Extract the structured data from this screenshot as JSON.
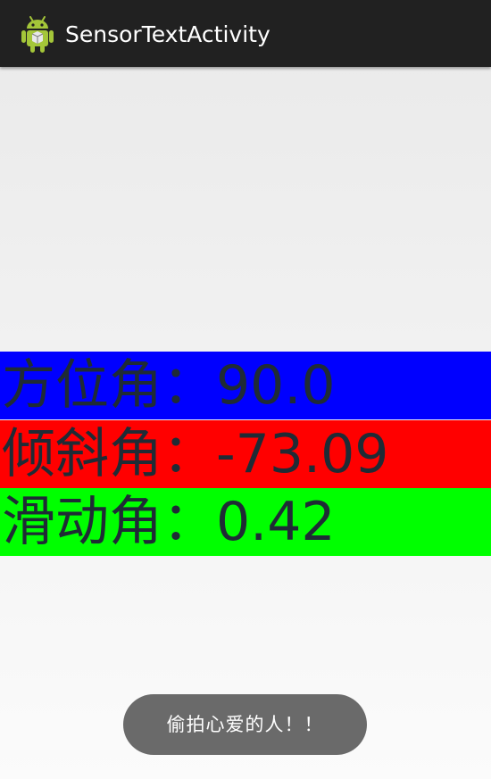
{
  "action_bar": {
    "title": "SensorTextActivity",
    "icon": "android-robot-icon"
  },
  "sensors": [
    {
      "label": "方位角：",
      "value": "90.0",
      "background": "#0000ff"
    },
    {
      "label": "倾斜角：",
      "value": "-73.09",
      "background": "#ff0000"
    },
    {
      "label": "滑动角：",
      "value": "0.42",
      "background": "#00ff00"
    }
  ],
  "toast": {
    "message": "偷拍心爱的人！！"
  },
  "colors": {
    "action_bar": "#212121",
    "sensor_text": "#1f2b35",
    "toast_bg": "#6a6a6a"
  }
}
